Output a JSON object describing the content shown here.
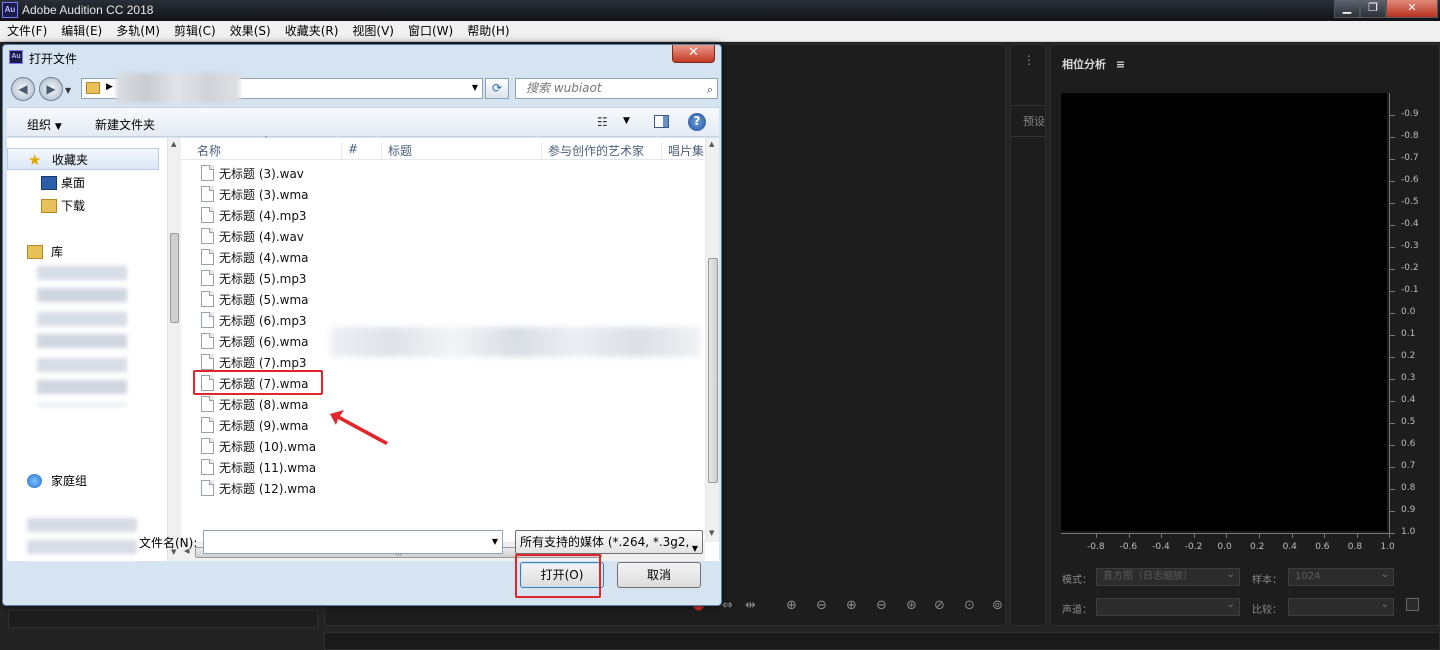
{
  "app": {
    "icon_text": "Au",
    "title": "Adobe Audition CC 2018",
    "window_controls": {
      "minimize": "▁",
      "restore": "❐",
      "close": "✕"
    }
  },
  "menu": [
    "文件(F)",
    "编辑(E)",
    "多轨(M)",
    "剪辑(C)",
    "效果(S)",
    "收藏夹(R)",
    "视图(V)",
    "窗口(W)",
    "帮助(H)"
  ],
  "phase_panel": {
    "title": "相位分析",
    "menu_icon": "≡",
    "y_ticks": [
      "0.9",
      "0.8",
      "0.7",
      "0.6",
      "0.5",
      "0.4",
      "0.3",
      "0.2",
      "0.1",
      "0.0",
      "0.1",
      "0.2",
      "0.3",
      "0.4",
      "0.5",
      "0.6",
      "0.7",
      "0.8",
      "0.9",
      "1.0"
    ],
    "y_prefix_top": "-",
    "x_ticks": [
      "-0.8",
      "-0.6",
      "-0.4",
      "-0.2",
      "0.0",
      "0.2",
      "0.4",
      "0.6",
      "0.8",
      "1.0"
    ],
    "y_last": "1.0",
    "mode_label": "模式：",
    "mode_value": "直方图（日志缩放）",
    "sample_label": "样本：",
    "sample_value": "1024",
    "channel_label": "声道：",
    "compare_label": "比较："
  },
  "side_tab": "预设",
  "dialog": {
    "icon_text": "Au",
    "title": "打开文件",
    "close_glyph": "✕",
    "search_placeholder": "搜索 wubiaot",
    "toolbar": {
      "organize": "组织",
      "new_folder": "新建文件夹"
    },
    "tree": {
      "favorites": "收藏夹",
      "desktop": "桌面",
      "downloads": "下载",
      "library": "库",
      "homegroup": "家庭组"
    },
    "columns": [
      "名称",
      "#",
      "标题",
      "参与创作的艺术家",
      "唱片集"
    ],
    "files": [
      "无标题 (3).wav",
      "无标题 (3).wma",
      "无标题 (4).mp3",
      "无标题 (4).wav",
      "无标题 (4).wma",
      "无标题 (5).mp3",
      "无标题 (5).wma",
      "无标题 (6).mp3",
      "无标题 (6).wma",
      "无标题 (7).mp3",
      "无标题 (7).wma",
      "无标题 (8).wma",
      "无标题 (9).wma",
      "无标题 (10).wma",
      "无标题 (11).wma",
      "无标题 (12).wma"
    ],
    "filename_label": "文件名(N):",
    "filename_value": "",
    "filetype_value": "所有支持的媒体 (*.264, *.3g2,",
    "open_button": "打开(O)",
    "cancel_button": "取消"
  },
  "colors": {
    "highlight": "#e0262b",
    "app_bg": "#232323",
    "dialog_frame": "#d6e3f1"
  }
}
